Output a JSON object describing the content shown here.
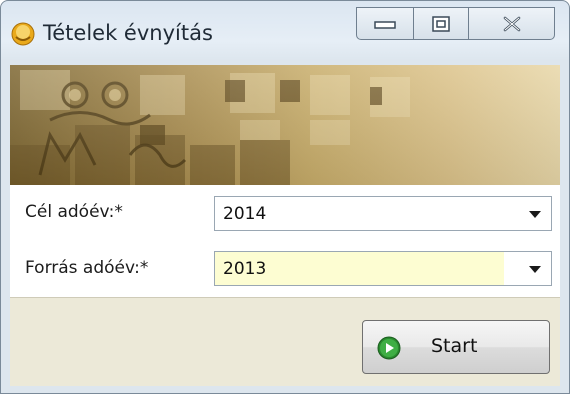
{
  "window": {
    "title": "Tételek évnyítás"
  },
  "form": {
    "target_year_label": "Cél adóév:*",
    "target_year_value": "2014",
    "source_year_label": "Forrás adóév:*",
    "source_year_value": "2013"
  },
  "footer": {
    "start_label": "Start"
  },
  "colors": {
    "required_field_bg": "#fdfdd2",
    "banner_gold": "#b39650",
    "start_icon_green": "#2a8a2e"
  },
  "icons": {
    "app": "app-icon",
    "minimize": "minimize-icon",
    "maximize": "maximize-icon",
    "close": "close-icon",
    "dropdown": "chevron-down-icon",
    "start": "play-icon"
  }
}
